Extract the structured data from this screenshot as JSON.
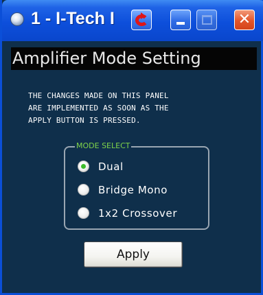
{
  "window": {
    "title": "1 - I-Tech I"
  },
  "titlebar": {
    "app_icon": "app-icon",
    "buttons": [
      {
        "name": "recycle",
        "icon": "recycle-icon"
      },
      {
        "name": "minimize",
        "icon": "minimize-icon"
      },
      {
        "name": "maximize",
        "icon": "maximize-icon",
        "state": "disabled"
      },
      {
        "name": "close",
        "icon": "close-icon",
        "glyph": "✕"
      }
    ]
  },
  "panel": {
    "heading": "Amplifier Mode Setting",
    "notice_lines": [
      "THE CHANGES MADE ON THIS PANEL",
      "ARE IMPLEMENTED AS SOON AS THE",
      "APPLY BUTTON IS PRESSED."
    ],
    "mode_select": {
      "label": "MODE SELECT",
      "options": [
        {
          "label": "Dual",
          "checked": true
        },
        {
          "label": "Bridge Mono",
          "checked": false
        },
        {
          "label": "1x2 Crossover",
          "checked": false
        }
      ]
    },
    "apply_label": "Apply"
  },
  "colors": {
    "panel_bg": "#0f2f4b",
    "titlebar": "#0d4fdb",
    "group_label": "#7fd34a",
    "radio_checked": "#3dbb2a",
    "close_button": "#e2552a"
  }
}
